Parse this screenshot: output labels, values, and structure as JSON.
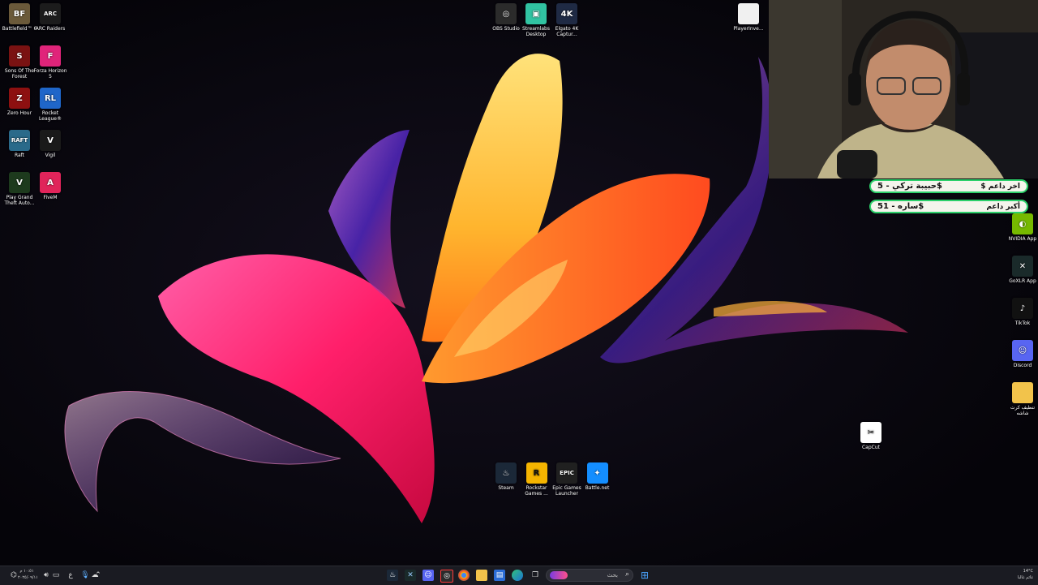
{
  "desktop_left": [
    {
      "label": "Battlefield™ 6",
      "icon": "battlefield-icon",
      "bg": "#6b5a3a",
      "glyph": "BF"
    },
    {
      "label": "ARC Raiders",
      "icon": "arc-raiders-icon",
      "bg": "#1c1c1c",
      "glyph": "ARC"
    },
    {
      "label": "Sons Of The Forest",
      "icon": "sons-of-the-forest-icon",
      "bg": "#7a1212",
      "glyph": "S"
    },
    {
      "label": "Forza Horizon 5",
      "icon": "forza-horizon-icon",
      "bg": "#e0247a",
      "glyph": "F"
    },
    {
      "label": "Zero Hour",
      "icon": "zero-hour-icon",
      "bg": "#8d1010",
      "glyph": "Z"
    },
    {
      "label": "Rocket League®",
      "icon": "rocket-league-icon",
      "bg": "#1f66c9",
      "glyph": "RL"
    },
    {
      "label": "Raft",
      "icon": "raft-icon",
      "bg": "#2a6a8a",
      "glyph": "RAFT"
    },
    {
      "label": "Vigil",
      "icon": "vigil-icon",
      "bg": "#1a1a1a",
      "glyph": "V"
    },
    {
      "label": "Play Grand Theft Auto...",
      "icon": "gta-icon",
      "bg": "#1d3a1d",
      "glyph": "V"
    },
    {
      "label": "FiveM",
      "icon": "fivem-icon",
      "bg": "#e0245a",
      "glyph": "A"
    }
  ],
  "desktop_top": [
    {
      "label": "OBS Studio",
      "icon": "obs-icon",
      "bg": "#2b2b2b",
      "glyph": "◎"
    },
    {
      "label": "Streamlabs Desktop",
      "icon": "streamlabs-icon",
      "bg": "#31c3a2",
      "glyph": "▣"
    },
    {
      "label": "Elgato 4K Captur...",
      "icon": "elgato-icon",
      "bg": "#1f2a44",
      "glyph": "4K"
    },
    {
      "label": "PlayerInve...",
      "icon": "file-icon",
      "bg": "#f0f0f0",
      "glyph": ""
    }
  ],
  "desktop_center": [
    {
      "label": "Steam",
      "icon": "steam-icon",
      "bg": "#1b2838",
      "glyph": "♨"
    },
    {
      "label": "Rockstar Games ...",
      "icon": "rockstar-icon",
      "bg": "#f5b400",
      "glyph": "R"
    },
    {
      "label": "Epic Games Launcher",
      "icon": "epic-games-icon",
      "bg": "#202020",
      "glyph": "EPIC"
    },
    {
      "label": "Battle.net",
      "icon": "battlenet-icon",
      "bg": "#148eff",
      "glyph": "✦"
    }
  ],
  "desktop_right": [
    {
      "label": "NVIDIA App",
      "icon": "nvidia-icon",
      "bg": "#76b900",
      "glyph": "◐"
    },
    {
      "label": "GoXLR App",
      "icon": "goxlr-icon",
      "bg": "#1a2a2a",
      "glyph": "✕"
    },
    {
      "label": "TikTok",
      "icon": "tiktok-icon",
      "bg": "#111111",
      "glyph": "♪"
    },
    {
      "label": "Discord",
      "icon": "discord-icon",
      "bg": "#5865f2",
      "glyph": "☺"
    },
    {
      "label": "تنظيف كرت شاشه",
      "icon": "folder-icon",
      "bg": "#f2c34b",
      "glyph": ""
    }
  ],
  "capcut": {
    "label": "CapCut",
    "icon": "capcut-icon",
    "bg": "#ffffff",
    "glyph": "✂"
  },
  "donations": [
    {
      "label": "$ اخر داعم",
      "value": "حبيبة تركي - 5$"
    },
    {
      "label": "أكبر داعم",
      "value": "ساره - 51$"
    }
  ],
  "taskbar": {
    "search_placeholder": "بحث",
    "weather_temp": "14°C",
    "weather_text": "غائم غالبا",
    "time": "١٠:٥١ م",
    "date": "٢٠٢٥/٠٩/١١",
    "lang": "ع"
  }
}
